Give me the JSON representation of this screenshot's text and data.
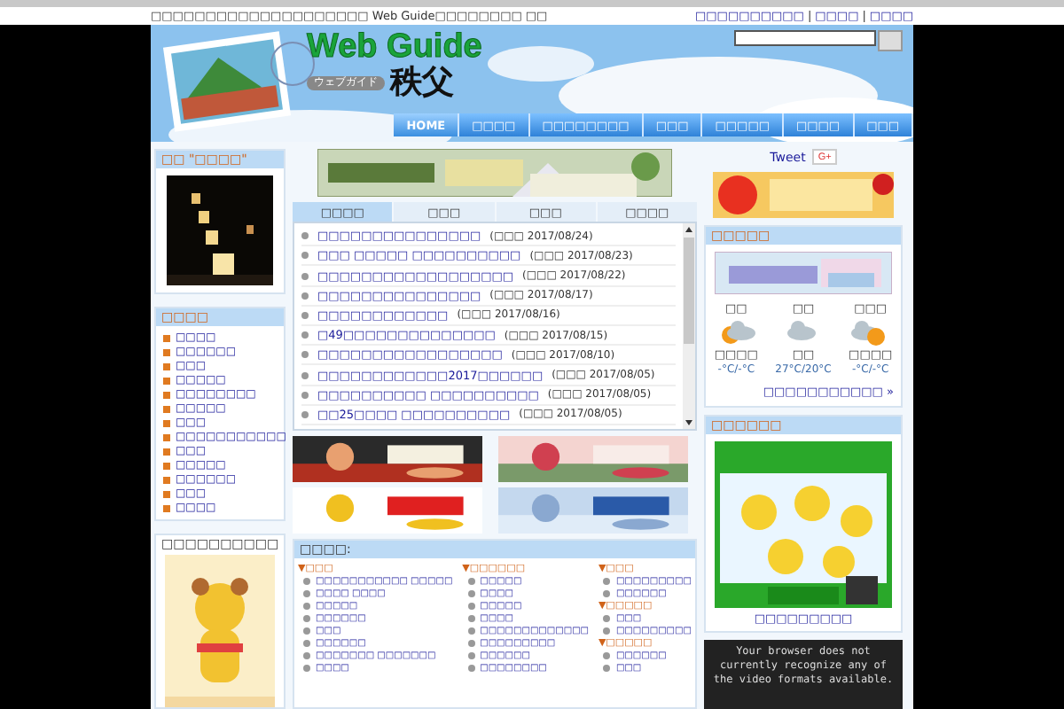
{
  "top_bar": {
    "tagline": "□□□□□□□□□□□□□□□□□□□□ Web Guide□□□□□□□□ □□",
    "links": [
      "□□□□□□□□□□",
      "□□□□",
      "□□□□"
    ],
    "separator": "|"
  },
  "header": {
    "logo_title": "Web Guide",
    "logo_subtitle": "ウェブガイド",
    "logo_city": "秩父"
  },
  "nav": [
    {
      "label": "HOME",
      "selected": true
    },
    {
      "label": "□□□□",
      "selected": false
    },
    {
      "label": "□□□□□□□□",
      "selected": false
    },
    {
      "label": "□□□",
      "selected": false
    },
    {
      "label": "□□□□□",
      "selected": false
    },
    {
      "label": "□□□□",
      "selected": false
    },
    {
      "label": "□□□",
      "selected": false
    }
  ],
  "left": {
    "photo_box": {
      "title": "□□ \"□□□□\""
    },
    "menu": {
      "title": "□□□□",
      "items": [
        "□□□□",
        "□□□□□□",
        "□□□",
        "□□□□□",
        "□□□□□□□□",
        "□□□□□",
        "□□□",
        "□□□□□□□□□□□",
        "□□□",
        "□□□□□",
        "□□□□□□",
        "□□□",
        "□□□□"
      ]
    },
    "mascot_box": {
      "title": "□□□□□□□□□□"
    }
  },
  "tabs": [
    {
      "label": "□□□□",
      "selected": true
    },
    {
      "label": "□□□",
      "selected": false
    },
    {
      "label": "□□□",
      "selected": false
    },
    {
      "label": "□□□□",
      "selected": false
    }
  ],
  "news": [
    {
      "title": "□□□□□□□□□□□□□□□",
      "date": "(□□□ 2017/08/24)"
    },
    {
      "title": "□□□ □□□□□ □□□□□□□□□□",
      "date": "(□□□ 2017/08/23)"
    },
    {
      "title": "□□□□□□□□□□□□□□□□□□",
      "date": "(□□□ 2017/08/22)"
    },
    {
      "title": "□□□□□□□□□□□□□□□",
      "date": "(□□□ 2017/08/17)"
    },
    {
      "title": "□□□□□□□□□□□□",
      "date": "(□□□ 2017/08/16)"
    },
    {
      "title": "□49□□□□□□□□□□□□□□",
      "date": "(□□□ 2017/08/15)"
    },
    {
      "title": "□□□□□□□□□□□□□□□□□",
      "date": "(□□□ 2017/08/10)"
    },
    {
      "title": "□□□□□□□□□□□□2017□□□□□□",
      "date": "(□□□ 2017/08/05)"
    },
    {
      "title": "□□□□□□□□□□ □□□□□□□□□□",
      "date": "(□□□ 2017/08/05)"
    },
    {
      "title": "□□25□□□□ □□□□□□□□□□",
      "date": "(□□□ 2017/08/05)"
    }
  ],
  "categories": {
    "title": "□□□□:",
    "columns": [
      [
        {
          "heading": "▼□□□",
          "items": [
            "□□□□□□□□□□□ □□□□□",
            "□□□□ □□□□",
            "□□□□□",
            "□□□□□□",
            "□□□",
            "□□□□□□",
            "□□□□□□□ □□□□□□□",
            "□□□□"
          ]
        }
      ],
      [
        {
          "heading": "▼□□□□□□",
          "items": [
            "□□□□□",
            "□□□□",
            "□□□□□",
            "□□□□",
            "□□□□□□□□□□□□□",
            "□□□□□□□□□",
            "□□□□□□",
            "□□□□□□□□"
          ]
        }
      ],
      [
        {
          "heading": "▼□□□",
          "items": [
            "□□□□□□□□□",
            "□□□□□□"
          ]
        },
        {
          "heading": "▼□□□□□",
          "items": [
            "□□□",
            "□□□□□□□□□"
          ]
        },
        {
          "heading": "▼□□□□□",
          "items": [
            "□□□□□□",
            "□□□"
          ]
        }
      ]
    ]
  },
  "right": {
    "social": {
      "tweet": "Tweet",
      "gplus": "G+"
    },
    "weather": {
      "title": "□□□□□",
      "days": [
        {
          "day": "□□",
          "kind": "sun-cloud",
          "condition": "□□□□",
          "temps": "-°C/-°C"
        },
        {
          "day": "□□",
          "kind": "cloud",
          "condition": "□□",
          "temps": "27°C/20°C"
        },
        {
          "day": "□□□",
          "kind": "cloud-sun",
          "condition": "□□□□",
          "temps": "-°C/-°C"
        }
      ],
      "link": "□□□□□□□□□□□ »"
    },
    "line_box": {
      "title": "□□□□□□",
      "caption": "□□□□□□□□□"
    },
    "video": {
      "message": "Your browser does not currently recognize any of the video formats available."
    }
  }
}
